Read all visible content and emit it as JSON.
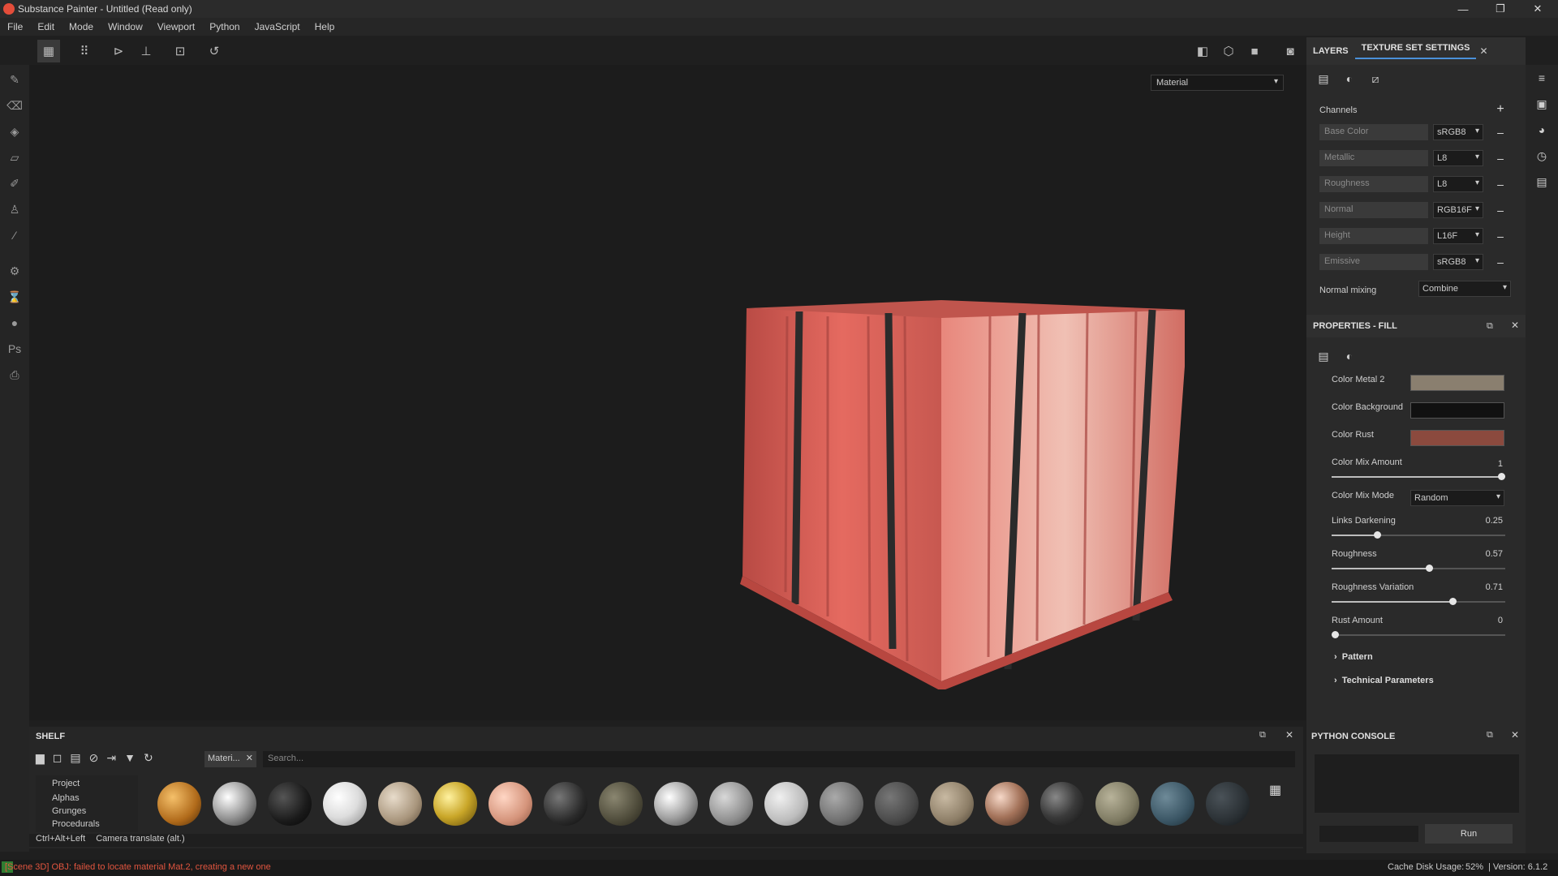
{
  "window": {
    "title": "Substance Painter - Untitled (Read only)",
    "minimize": "—",
    "maximize": "❐",
    "close": "✕"
  },
  "menu": [
    "File",
    "Edit",
    "Mode",
    "Window",
    "Viewport",
    "Python",
    "JavaScript",
    "Help"
  ],
  "viewport": {
    "mode_select": "Material"
  },
  "layers_panel": {
    "tab_layers": "LAYERS",
    "tab_texture_set": "TEXTURE SET SETTINGS",
    "channels_label": "Channels",
    "channels": [
      {
        "name": "Base Color",
        "format": "sRGB8"
      },
      {
        "name": "Metallic",
        "format": "L8"
      },
      {
        "name": "Roughness",
        "format": "L8"
      },
      {
        "name": "Normal",
        "format": "RGB16F"
      },
      {
        "name": "Height",
        "format": "L16F"
      },
      {
        "name": "Emissive",
        "format": "sRGB8"
      }
    ],
    "normal_mixing_label": "Normal mixing",
    "normal_mixing_value": "Combine"
  },
  "properties": {
    "title": "PROPERTIES - FILL",
    "color_metal2_label": "Color Metal 2",
    "color_metal2": "#8a7f6f",
    "color_background_label": "Color Background",
    "color_background": "#111111",
    "color_rust_label": "Color Rust",
    "color_rust": "#8b4a3e",
    "color_mix_amount_label": "Color Mix Amount",
    "color_mix_amount": "1",
    "color_mix_mode_label": "Color Mix Mode",
    "color_mix_mode": "Random",
    "links_darkening_label": "Links Darkening",
    "links_darkening": "0.25",
    "roughness_label": "Roughness",
    "roughness": "0.57",
    "roughness_variation_label": "Roughness Variation",
    "roughness_variation": "0.71",
    "rust_amount_label": "Rust Amount",
    "rust_amount": "0",
    "pattern_label": "Pattern",
    "technical_label": "Technical Parameters"
  },
  "shelf": {
    "title": "SHELF",
    "filter_tag": "Materi...",
    "search_placeholder": "Search...",
    "categories": [
      "Project",
      "Alphas",
      "Grunges",
      "Procedurals"
    ]
  },
  "console": {
    "title": "PYTHON CONSOLE",
    "run_label": "Run"
  },
  "hint": {
    "shortcut": "Ctrl+Alt+Left",
    "action": "Camera translate (alt.)"
  },
  "status": {
    "error": "[Scene 3D] OBJ: failed to locate material Mat.2, creating a new one",
    "cache": "Cache Disk Usage:",
    "cache_value": "52%",
    "version": "| Version: 6.1.2"
  }
}
